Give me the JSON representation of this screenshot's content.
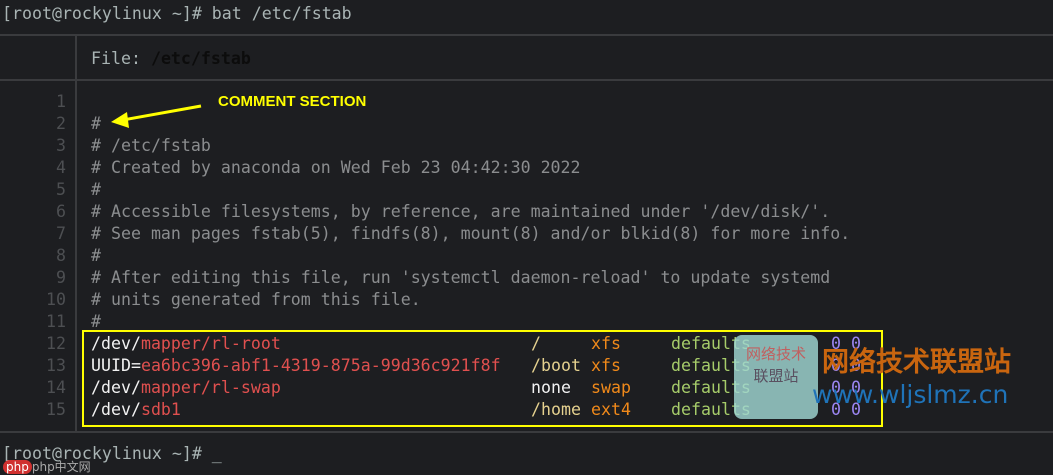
{
  "terminal": {
    "command_prompt": "[root@rockylinux ~]# ",
    "command": "bat /etc/fstab",
    "final_prompt": "[root@rockylinux ~]# ",
    "cursor": "_"
  },
  "bat": {
    "file_label": "File: ",
    "file_name": "/etc/fstab",
    "lines": [
      {
        "n": "1",
        "text": ""
      },
      {
        "n": "2",
        "text": "#"
      },
      {
        "n": "3",
        "text": "# /etc/fstab"
      },
      {
        "n": "4",
        "text": "# Created by anaconda on Wed Feb 23 04:42:30 2022"
      },
      {
        "n": "5",
        "text": "#"
      },
      {
        "n": "6",
        "text": "# Accessible filesystems, by reference, are maintained under '/dev/disk/'."
      },
      {
        "n": "7",
        "text": "# See man pages fstab(5), findfs(8), mount(8) and/or blkid(8) for more info."
      },
      {
        "n": "8",
        "text": "#"
      },
      {
        "n": "9",
        "text": "# After editing this file, run 'systemctl daemon-reload' to update systemd"
      },
      {
        "n": "10",
        "text": "# units generated from this file."
      },
      {
        "n": "11",
        "text": "#"
      }
    ],
    "entries": [
      {
        "n": "12",
        "dev_prefix": "/dev/",
        "dev": "mapper/rl-root",
        "mount": "/",
        "fs": "xfs",
        "opts": "defaults",
        "dump": "0",
        "pass": "0"
      },
      {
        "n": "13",
        "dev_prefix": "UUID=",
        "dev": "ea6bc396-abf1-4319-875a-99d36c921f8f",
        "mount": "/boot",
        "fs": "xfs",
        "opts": "defaults",
        "dump": "0",
        "pass": "0"
      },
      {
        "n": "14",
        "dev_prefix": "/dev/",
        "dev": "mapper/rl-swap",
        "mount": "none",
        "fs": "swap",
        "opts": "defaults",
        "dump": "0",
        "pass": "0"
      },
      {
        "n": "15",
        "dev_prefix": "/dev/",
        "dev": "sdb1",
        "mount": "/home",
        "fs": "ext4",
        "opts": "defaults",
        "dump": "0",
        "pass": "0"
      }
    ]
  },
  "annotation": {
    "label": "COMMENT SECTION",
    "color": "#ffff00"
  },
  "watermarks": {
    "box_text_1": "网络技术",
    "box_text_2": "联盟站",
    "site_name": "网络技术联盟站",
    "site_url": "www.wljslmz.cn",
    "corner_logo": "php中文网"
  }
}
